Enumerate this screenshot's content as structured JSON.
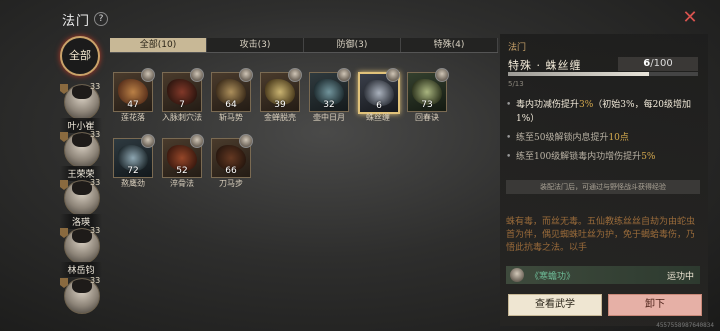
{
  "header": {
    "title": "法门",
    "help": "?"
  },
  "left": {
    "all_label": "全部",
    "characters": [
      {
        "name": "叶小崔",
        "level": "33"
      },
      {
        "name": "王荣荣",
        "level": "33"
      },
      {
        "name": "洛瑛",
        "level": "33"
      },
      {
        "name": "林岳钧",
        "level": "33"
      },
      {
        "name": "",
        "level": "33"
      }
    ]
  },
  "tabs": [
    {
      "label": "全部(10)"
    },
    {
      "label": "攻击(3)"
    },
    {
      "label": "防御(3)"
    },
    {
      "label": "特殊(4)"
    }
  ],
  "skills": [
    {
      "name": "莲花落",
      "count": "47"
    },
    {
      "name": "入脉刺穴法",
      "count": "7"
    },
    {
      "name": "斩马势",
      "count": "64"
    },
    {
      "name": "金蝉脱壳",
      "count": "39"
    },
    {
      "name": "壶中日月",
      "count": "32"
    },
    {
      "name": "蛛丝缠",
      "count": "6"
    },
    {
      "name": "回春诀",
      "count": "73"
    },
    {
      "name": "熬鹰劲",
      "count": "72"
    },
    {
      "name": "淬骨法",
      "count": "52"
    },
    {
      "name": "刀马步",
      "count": "66"
    }
  ],
  "panel": {
    "section": "法门",
    "title": "特殊 · 蛛丝缠",
    "count_current": "6",
    "count_total": "/100",
    "progress": 0.74,
    "level_text": "5/13",
    "effects": [
      {
        "text_a": "毒内功减伤提升",
        "hl_a": "3%",
        "text_b": "（初始3%，每20级增加1%）"
      },
      {
        "text_a": "练至50级解锁内息提升",
        "hl_a": "10点",
        "text_b": ""
      },
      {
        "text_a": "练至100级解锁毒内功增伤提升",
        "hl_a": "5%",
        "text_b": ""
      }
    ],
    "hint": "装配法门后，可通过与野怪战斗获得经验",
    "description": "蛛有毒，而丝无毒。五仙教练丝丝自劫为由蛇虫首为伴，偶见蜘蛛吐丝为护，免于蝎蛤毒伤，乃悟此抗毒之法。以手",
    "bound_skill": "《寒蟾功》",
    "bound_status": "运功中",
    "btn_view": "查看武学",
    "btn_unload": "卸下"
  },
  "uid": "4557558987640834",
  "colors": {
    "accent": "#c9a36a",
    "selected": "#e1c27a",
    "green": "#6fbf9a",
    "danger": "#d9534f"
  }
}
